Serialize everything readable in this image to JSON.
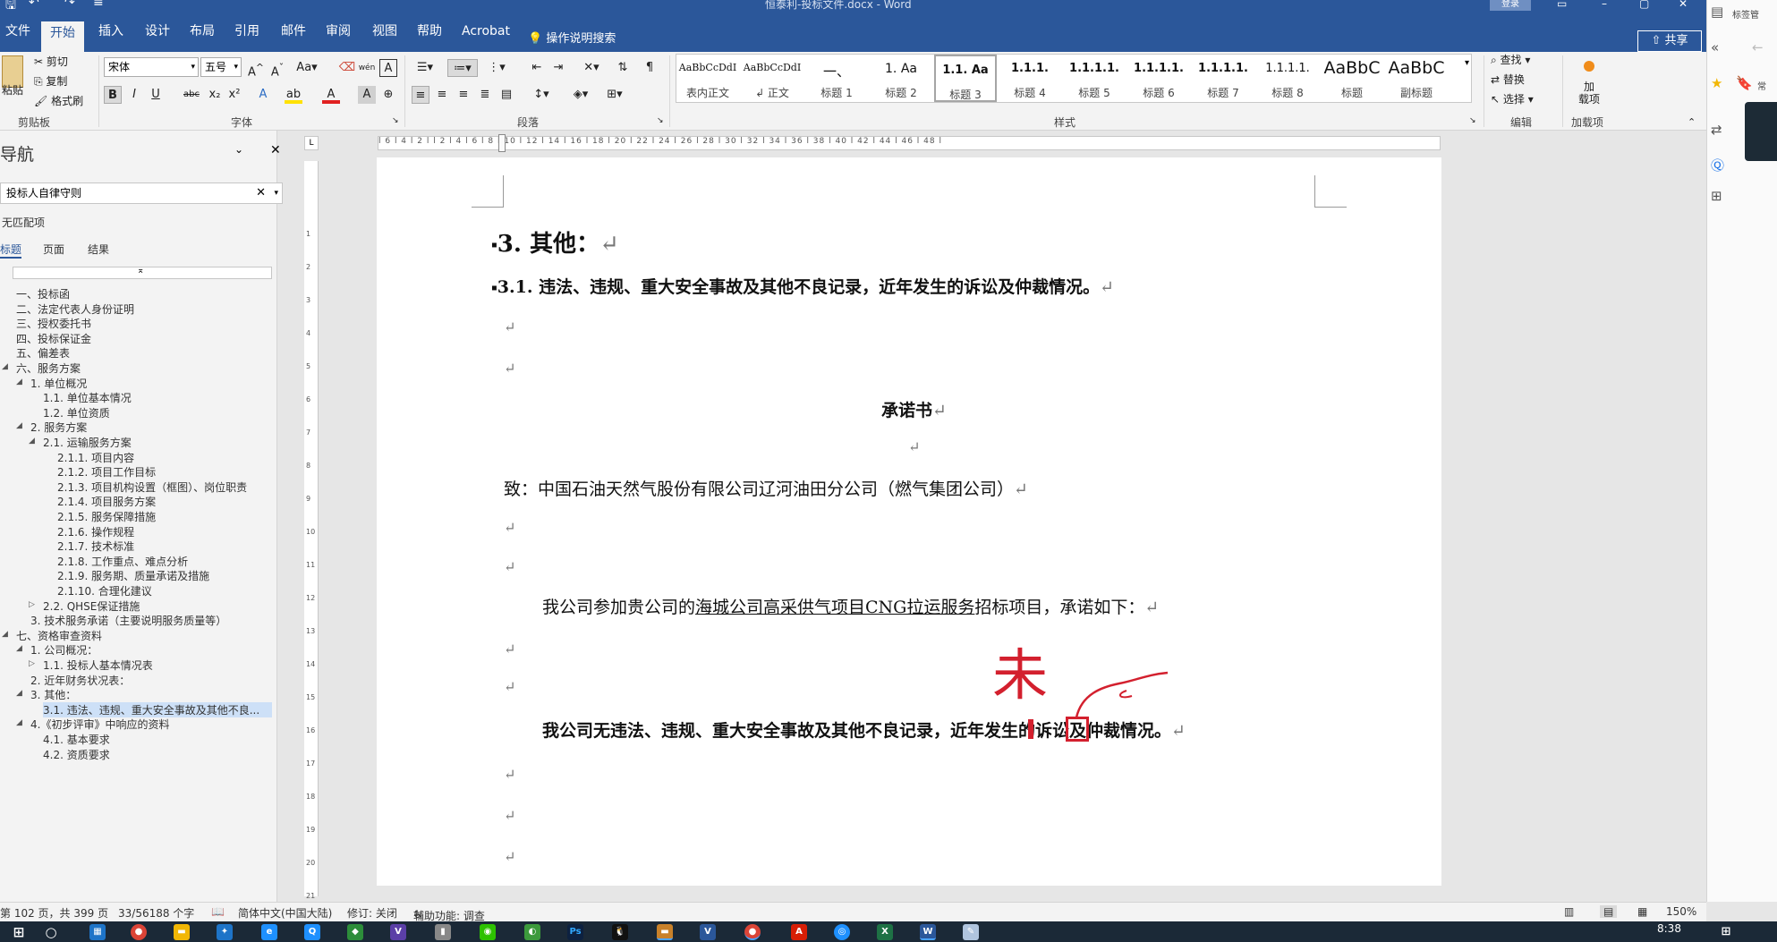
{
  "window": {
    "title": "恒泰利-投标文件.docx - Word",
    "login_label": "登录",
    "quick_access": [
      "save-icon",
      "undo-icon",
      "redo-icon",
      "customize-icon"
    ]
  },
  "tabs": [
    "文件",
    "开始",
    "插入",
    "设计",
    "布局",
    "引用",
    "邮件",
    "审阅",
    "视图",
    "帮助",
    "Acrobat"
  ],
  "active_tab": "开始",
  "tell_me": "操作说明搜索",
  "share_label": "共享",
  "ribbon": {
    "clipboard": {
      "paste": "粘贴",
      "cut": "剪切",
      "copy": "复制",
      "format_painter": "格式刷",
      "group": "剪贴板"
    },
    "font": {
      "font_name": "宋体",
      "font_size": "五号",
      "group": "字体",
      "buttons": [
        "B",
        "I",
        "U",
        "abc",
        "x₂",
        "x²",
        "A",
        "ab",
        "A",
        "A",
        "⊕"
      ]
    },
    "paragraph": {
      "group": "段落"
    },
    "styles": {
      "group": "样式",
      "items": [
        {
          "sample": "AaBbCcDdI",
          "name": "表内正文"
        },
        {
          "sample": "AaBbCcDdI",
          "name": "↲ 正文"
        },
        {
          "sample": "一、",
          "name": "标题 1"
        },
        {
          "sample": "1.   Aa",
          "name": "标题 2"
        },
        {
          "sample": "1.1.  Aa",
          "name": "标题 3"
        },
        {
          "sample": "1.1.1.",
          "name": "标题 4"
        },
        {
          "sample": "1.1.1.1.",
          "name": "标题 5"
        },
        {
          "sample": "1.1.1.1.",
          "name": "标题 6"
        },
        {
          "sample": "1.1.1.1.",
          "name": "标题 7"
        },
        {
          "sample": "1.1.1.1.",
          "name": "标题 8"
        },
        {
          "sample": "AaBbC",
          "name": "标题"
        },
        {
          "sample": "AaBbC",
          "name": "副标题"
        }
      ],
      "selected_index": 4
    },
    "editing": {
      "find": "查找",
      "replace": "替换",
      "select": "选择",
      "group": "编辑"
    },
    "addins": {
      "button_line1": "加",
      "button_line2": "载项",
      "group": "加载项"
    }
  },
  "nav": {
    "title": "导航",
    "search_value": "投标人自律守则",
    "no_match": "无匹配项",
    "tabs": [
      "标题",
      "页面",
      "结果"
    ],
    "active_tab": "标题",
    "headings": [
      {
        "text": "一、投标函"
      },
      {
        "text": "二、法定代表人身份证明"
      },
      {
        "text": "三、授权委托书"
      },
      {
        "text": "四、投标保证金"
      },
      {
        "text": "五、偏差表"
      },
      {
        "text": "六、服务方案"
      },
      {
        "text": "1. 单位概况"
      },
      {
        "text": "1.1. 单位基本情况"
      },
      {
        "text": "1.2. 单位资质"
      },
      {
        "text": "2. 服务方案"
      },
      {
        "text": "2.1. 运输服务方案"
      },
      {
        "text": "2.1.1. 项目内容"
      },
      {
        "text": "2.1.2. 项目工作目标"
      },
      {
        "text": "2.1.3. 项目机构设置（框图）、岗位职责"
      },
      {
        "text": "2.1.4. 项目服务方案"
      },
      {
        "text": "2.1.5. 服务保障措施"
      },
      {
        "text": "2.1.6. 操作规程"
      },
      {
        "text": "2.1.7. 技术标准"
      },
      {
        "text": "2.1.8. 工作重点、难点分析"
      },
      {
        "text": "2.1.9. 服务期、质量承诺及措施"
      },
      {
        "text": "2.1.10. 合理化建议"
      },
      {
        "text": "2.2. QHSE保证措施"
      },
      {
        "text": "3. 技术服务承诺（主要说明服务质量等）"
      },
      {
        "text": "七、资格审查资料"
      },
      {
        "text": "1. 公司概况："
      },
      {
        "text": "1.1. 投标人基本情况表"
      },
      {
        "text": "2. 近年财务状况表："
      },
      {
        "text": "3. 其他："
      },
      {
        "text": "3.1. 违法、违规、重大安全事故及其他不良..."
      },
      {
        "text": "4.《初步评审》中响应的资料"
      },
      {
        "text": "4.1. 基本要求"
      },
      {
        "text": "4.2. 资质要求"
      }
    ],
    "active_index": 28
  },
  "document": {
    "heading_3": "3. 其他：",
    "heading_31": "3.1. 违法、违规、重大安全事故及其他不良记录，近年发生的诉讼及仲裁情况。",
    "title": "承诺书",
    "addressee": "致：中国石油天然气股份有限公司辽河油田分公司（燃气集团公司）",
    "body_prefix": "我公司参加贵公司的",
    "body_project": "海城公司高采供气项目CNG拉运服务",
    "body_suffix": "招标项目，承诺如下：",
    "statement": "我公司无违法、违规、重大安全事故及其他不良记录，近年发生的诉讼及仲裁情况。",
    "handwritten_annotation": "未",
    "para_mark": "↵"
  },
  "ruler": {
    "numbers": "l 6 l 4 l 2 l  l 2 l 4 l 6 l 8 l 10 l 12 l 14 l 16 l 18 l 20 l 22 l 24 l 26 l 28 l 30 l 32 l 34 l 36 l 38 l 40 l 42 l 44 l 46 l 48 l"
  },
  "right_panel": {
    "top_label": "标签管",
    "side_label": "常"
  },
  "status": {
    "page": "第 102 页，共 399 页",
    "words": "33/56188 个字",
    "language": "简体中文(中国大陆)",
    "track_changes": "修订: 关闭",
    "accessibility": "辅助功能: 调查",
    "zoom": "150%"
  },
  "taskbar": {
    "time": "8:38",
    "apps": [
      "Windows",
      "搜索",
      "计算器",
      "Chrome",
      "文件资源管理器",
      "设置",
      "Edge",
      "钉钉",
      "QQ浏览器",
      "VS",
      "记事本",
      "微信",
      "绿色应用",
      "Photoshop",
      "QQ",
      "文件夹",
      "Visio",
      "Chrome",
      "Acrobat",
      "浏览器",
      "Excel",
      "Word",
      "工具"
    ]
  },
  "colors": {
    "word_blue": "#2b579a",
    "annotation_red": "#d3202e",
    "nav_highlight": "#cde0f7"
  }
}
